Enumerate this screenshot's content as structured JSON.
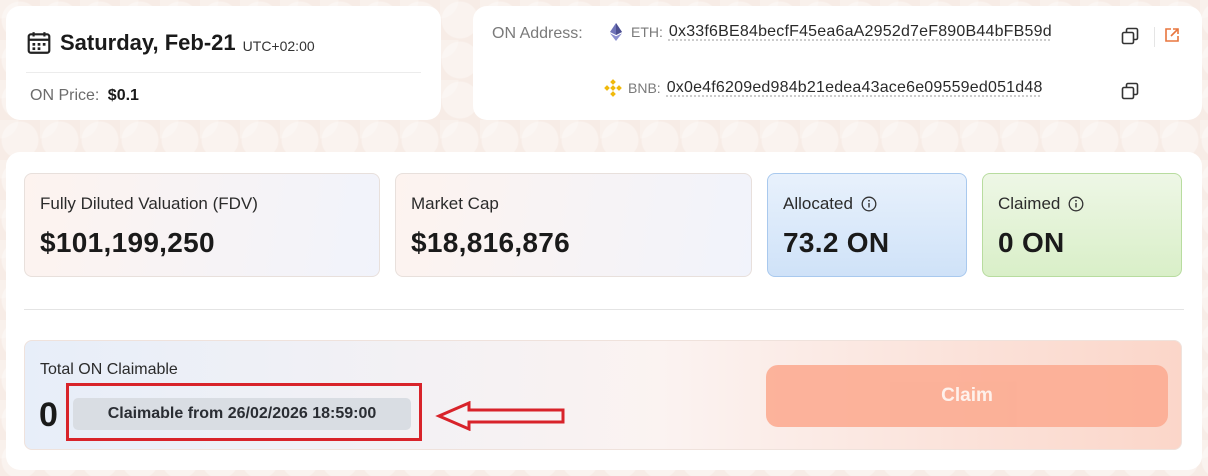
{
  "date_card": {
    "date": "Saturday, Feb-21",
    "timezone": "UTC+02:00",
    "price_label": "ON Price:",
    "price_value": "$0.1",
    "icon": "calendar-icon"
  },
  "address_card": {
    "label": "ON Address:",
    "eth": {
      "chain": "ETH:",
      "address": "0x33f6BE84becfF45ea6aA2952d7eF890B44bFB59d",
      "icon": "ethereum-icon"
    },
    "bnb": {
      "chain": "BNB:",
      "address": "0x0e4f6209ed984b21edea43ace6e09559ed051d48",
      "icon": "bnb-icon"
    }
  },
  "stats": {
    "fdv": {
      "label": "Fully Diluted Valuation (FDV)",
      "value": "$101,199,250"
    },
    "market_cap": {
      "label": "Market Cap",
      "value": "$18,816,876"
    },
    "allocated": {
      "label": "Allocated",
      "value": "73.2 ON"
    },
    "claimed": {
      "label": "Claimed",
      "value": "0 ON"
    }
  },
  "claim": {
    "title": "Total ON Claimable",
    "amount": "0",
    "badge": "Claimable from 26/02/2026 18:59:00",
    "button_label": "Claim"
  },
  "colors": {
    "accent_orange": "#fcac92",
    "highlight_red": "#d8232a",
    "allocated_blue": "#cfe2f8",
    "claimed_green": "#d9efc8"
  }
}
